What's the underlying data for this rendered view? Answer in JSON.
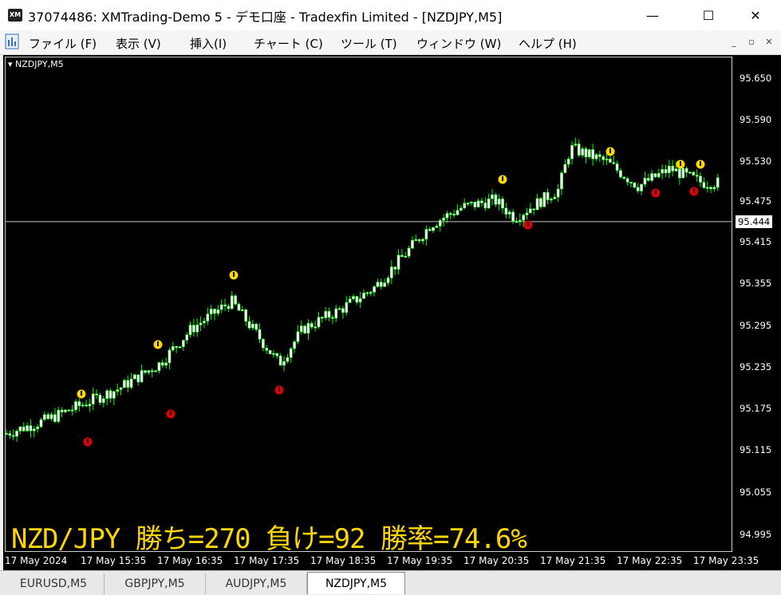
{
  "window": {
    "title": "37074486: XMTrading-Demo 5 - デモ口座 - Tradexfin Limited - [NZDJPY,M5]",
    "app_icon_text": "XM",
    "controls": {
      "minimize": "—",
      "maximize": "☐",
      "close": "✕"
    }
  },
  "menu": {
    "items": [
      "ファイル (F)",
      "表示 (V)",
      "挿入(I)",
      "チャート (C)",
      "ツール (T)",
      "ウィンドウ (W)",
      "ヘルプ (H)"
    ],
    "mdi": {
      "minimize": "_",
      "restore": "▫",
      "close": "✕"
    }
  },
  "chart": {
    "symbol_label": "NZDJPY,M5",
    "current_price": "95.444",
    "price_axis": [
      "95.650",
      "95.590",
      "95.530",
      "95.475",
      "95.415",
      "95.355",
      "95.295",
      "95.235",
      "95.175",
      "95.115",
      "95.055",
      "94.995"
    ],
    "time_axis": [
      "17 May 2024",
      "17 May 15:35",
      "17 May 16:35",
      "17 May 17:35",
      "17 May 18:35",
      "17 May 19:35",
      "17 May 20:35",
      "17 May 21:35",
      "17 May 22:35",
      "17 May 23:35"
    ],
    "stats_text": "NZD/JPY 勝ち=270 負け=92 勝率=74.6%",
    "colors": {
      "background": "#000000",
      "bull_candle": "#ffffff",
      "bear_candle": "#ffffff",
      "wick": "#00ff00",
      "up_signal": "#ffd700",
      "down_signal": "#e00000",
      "stats": "#ffd700"
    }
  },
  "tabs": {
    "items": [
      "EURUSD,M5",
      "GBPJPY,M5",
      "AUDJPY,M5",
      "NZDJPY,M5"
    ],
    "active": "NZDJPY,M5"
  }
}
